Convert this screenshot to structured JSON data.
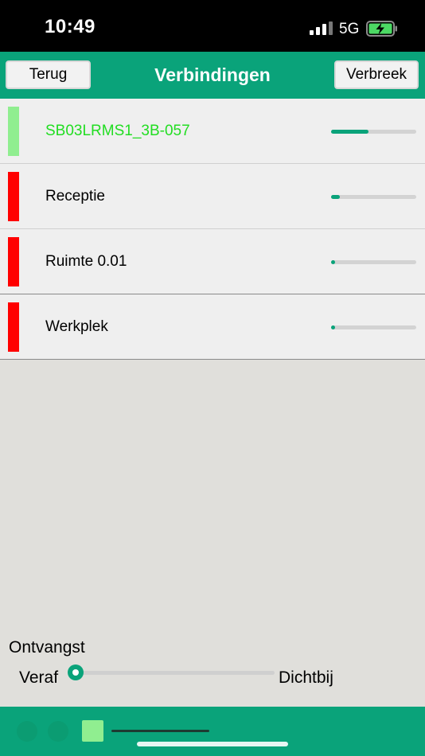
{
  "status_bar": {
    "time": "10:49",
    "network": "5G",
    "icons": [
      "signal-icon",
      "battery-charging-icon"
    ]
  },
  "nav": {
    "back_label": "Terug",
    "title": "Verbindingen",
    "disconnect_label": "Verbreek"
  },
  "connections": [
    {
      "name": "SB03LRMS1_3B-057",
      "status_color": "#90ee90",
      "text_color": "#22dd22",
      "signal": 0.44
    },
    {
      "name": "Receptie",
      "status_color": "#ff0000",
      "text_color": "#000000",
      "signal": 0.1
    },
    {
      "name": "Ruimte 0.01",
      "status_color": "#ff0000",
      "text_color": "#000000",
      "signal": 0.05
    },
    {
      "name": "Werkplek",
      "status_color": "#ff0000",
      "text_color": "#000000",
      "signal": 0.05
    }
  ],
  "reception": {
    "title": "Ontvangst",
    "min_label": "Veraf",
    "max_label": "Dichtbij",
    "value": 0
  },
  "colors": {
    "accent": "#0aa37a",
    "background": "#e0dfdb"
  }
}
